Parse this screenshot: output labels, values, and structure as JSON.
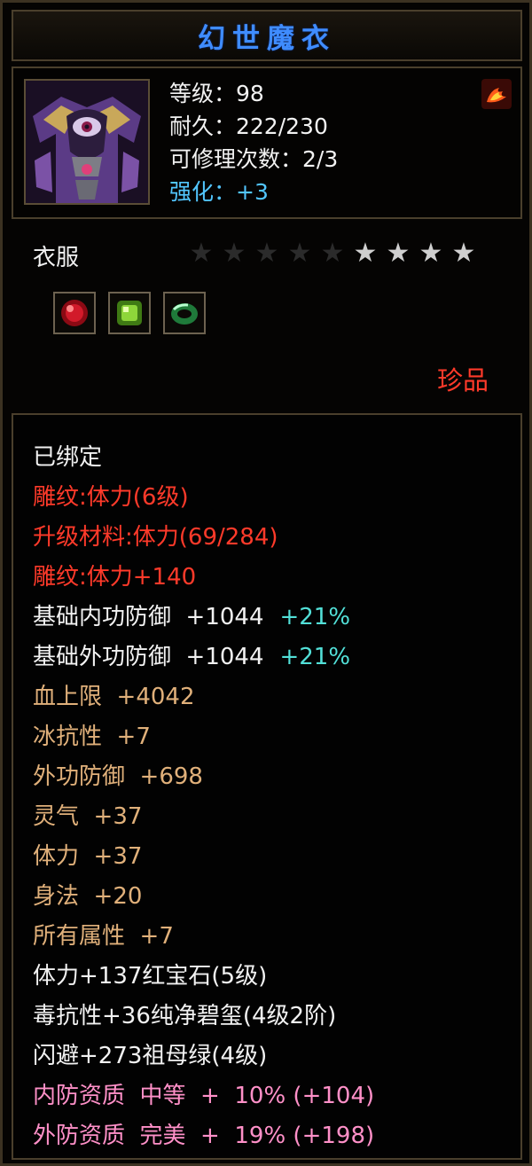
{
  "item": {
    "name": "幻世魔衣",
    "stats": [
      "等级：98",
      "耐久：222/230",
      "可修理次数：2/3"
    ],
    "enhance": "强化：+3",
    "type": "衣服",
    "stars_total": 9,
    "stars_lit": 4,
    "gems": [
      "red-ruby-gem-icon",
      "green-peridot-gem-icon",
      "green-jade-ring-icon"
    ],
    "quality": "珍品"
  },
  "lines": [
    {
      "text": "已绑定",
      "color": "#f2f2f2"
    },
    {
      "text": "雕纹:体力(6级)",
      "color": "#ff3a2a"
    },
    {
      "text": "升级材料:体力(69/284)",
      "color": "#ff3a2a"
    },
    {
      "text": "雕纹:体力+140",
      "color": "#ff3a2a"
    },
    {
      "text": "基础内功防御  +1044",
      "extra": "+21%",
      "color": "#f2f2f2"
    },
    {
      "text": "基础外功防御  +1044",
      "extra": "+21%",
      "color": "#f2f2f2"
    },
    {
      "text": "血上限  +4042",
      "color": "#e0b07a"
    },
    {
      "text": "冰抗性  +7",
      "color": "#e0b07a"
    },
    {
      "text": "外功防御  +698",
      "color": "#e0b07a"
    },
    {
      "text": "灵气  +37",
      "color": "#e0b07a"
    },
    {
      "text": "体力  +37",
      "color": "#e0b07a"
    },
    {
      "text": "身法  +20",
      "color": "#e0b07a"
    },
    {
      "text": "所有属性  +7",
      "color": "#e0b07a"
    },
    {
      "text": "体力+137红宝石(5级)",
      "color": "#f2f2f2"
    },
    {
      "text": "毒抗性+36纯净碧玺(4级2阶)",
      "color": "#f2f2f2"
    },
    {
      "text": "闪避+273祖母绿(4级)",
      "color": "#f2f2f2"
    },
    {
      "text": "内防资质  中等  +  10% (+104)",
      "color": "#ff90c8"
    },
    {
      "text": "外防资质  完美  +  19% (+198)",
      "color": "#ff90c8"
    }
  ]
}
